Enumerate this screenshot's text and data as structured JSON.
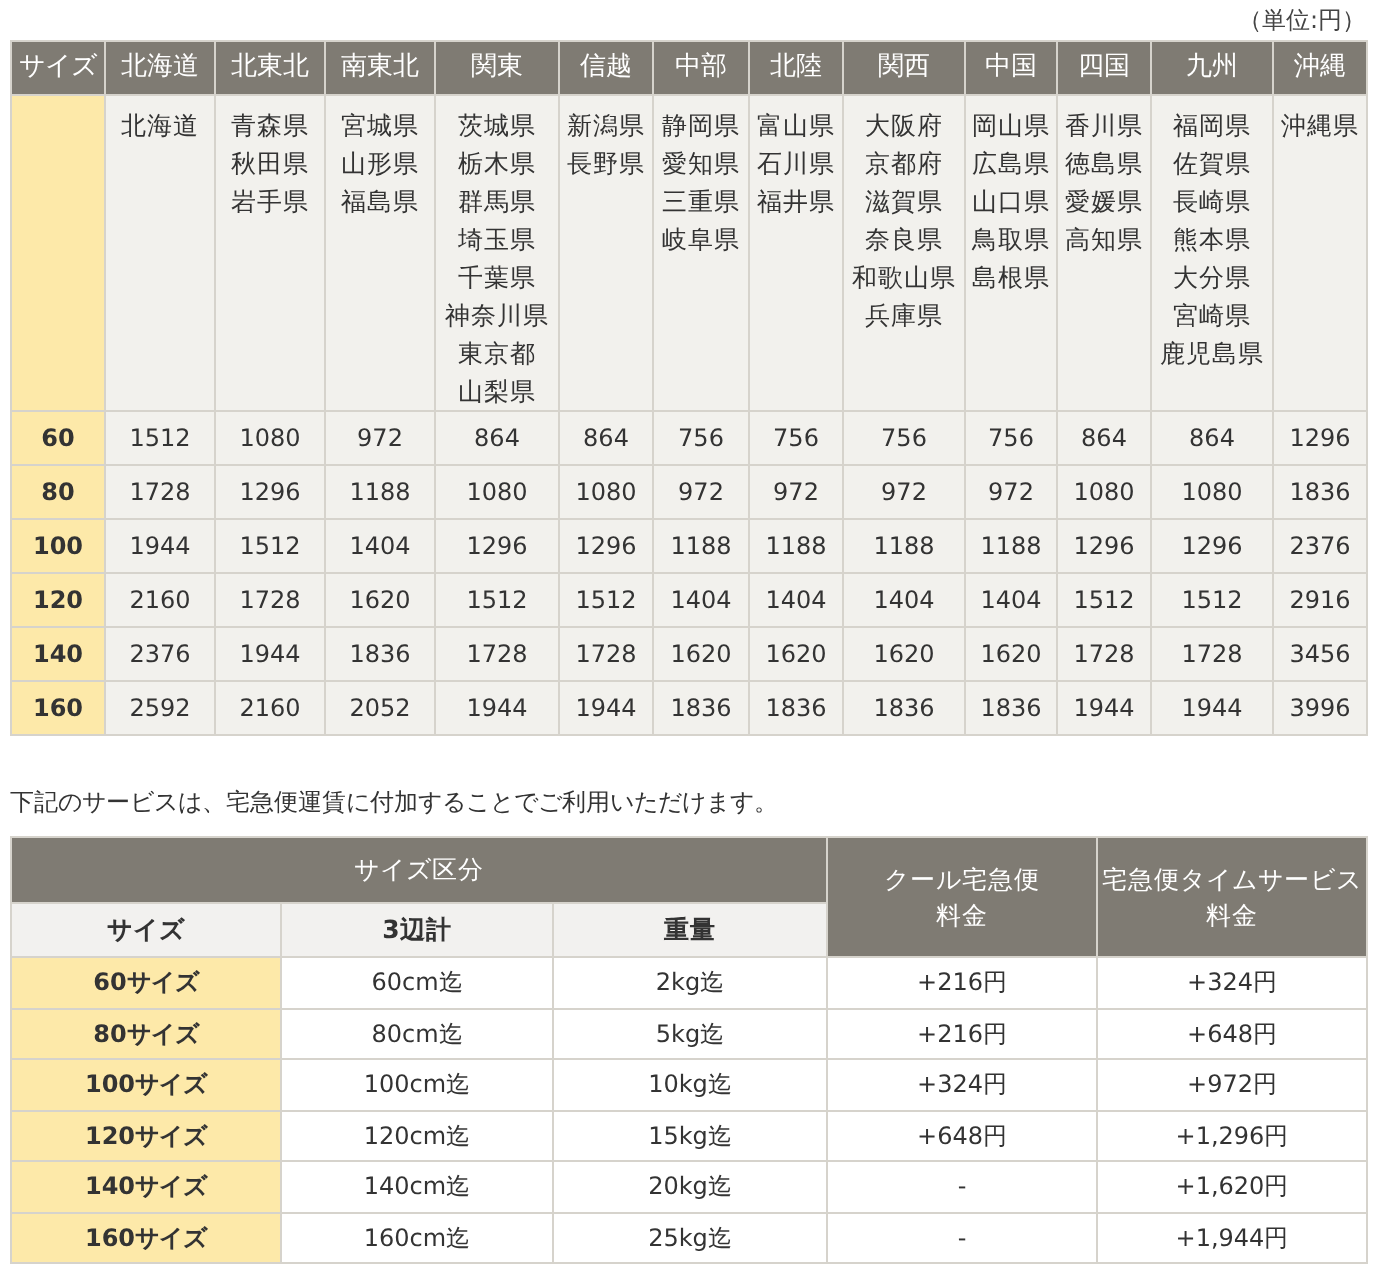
{
  "unit_note": "（単位:円）",
  "rate_table": {
    "corner": "サイズ",
    "regions": [
      {
        "name": "北海道",
        "prefectures": [
          "北海道"
        ]
      },
      {
        "name": "北東北",
        "prefectures": [
          "青森県",
          "秋田県",
          "岩手県"
        ]
      },
      {
        "name": "南東北",
        "prefectures": [
          "宮城県",
          "山形県",
          "福島県"
        ]
      },
      {
        "name": "関東",
        "prefectures": [
          "茨城県",
          "栃木県",
          "群馬県",
          "埼玉県",
          "千葉県",
          "神奈川県",
          "東京都",
          "山梨県"
        ]
      },
      {
        "name": "信越",
        "prefectures": [
          "新潟県",
          "長野県"
        ]
      },
      {
        "name": "中部",
        "prefectures": [
          "静岡県",
          "愛知県",
          "三重県",
          "岐阜県"
        ]
      },
      {
        "name": "北陸",
        "prefectures": [
          "富山県",
          "石川県",
          "福井県"
        ]
      },
      {
        "name": "関西",
        "prefectures": [
          "大阪府",
          "京都府",
          "滋賀県",
          "奈良県",
          "和歌山県",
          "兵庫県"
        ]
      },
      {
        "name": "中国",
        "prefectures": [
          "岡山県",
          "広島県",
          "山口県",
          "鳥取県",
          "島根県"
        ]
      },
      {
        "name": "四国",
        "prefectures": [
          "香川県",
          "徳島県",
          "愛媛県",
          "高知県"
        ]
      },
      {
        "name": "九州",
        "prefectures": [
          "福岡県",
          "佐賀県",
          "長崎県",
          "熊本県",
          "大分県",
          "宮崎県",
          "鹿児島県"
        ]
      },
      {
        "name": "沖縄",
        "prefectures": [
          "沖縄県"
        ]
      }
    ],
    "rows": [
      {
        "size": "60",
        "prices": [
          "1512",
          "1080",
          "972",
          "864",
          "864",
          "756",
          "756",
          "756",
          "756",
          "864",
          "864",
          "1296"
        ]
      },
      {
        "size": "80",
        "prices": [
          "1728",
          "1296",
          "1188",
          "1080",
          "1080",
          "972",
          "972",
          "972",
          "972",
          "1080",
          "1080",
          "1836"
        ]
      },
      {
        "size": "100",
        "prices": [
          "1944",
          "1512",
          "1404",
          "1296",
          "1296",
          "1188",
          "1188",
          "1188",
          "1188",
          "1296",
          "1296",
          "2376"
        ]
      },
      {
        "size": "120",
        "prices": [
          "2160",
          "1728",
          "1620",
          "1512",
          "1512",
          "1404",
          "1404",
          "1404",
          "1404",
          "1512",
          "1512",
          "2916"
        ]
      },
      {
        "size": "140",
        "prices": [
          "2376",
          "1944",
          "1836",
          "1728",
          "1728",
          "1620",
          "1620",
          "1620",
          "1620",
          "1728",
          "1728",
          "3456"
        ]
      },
      {
        "size": "160",
        "prices": [
          "2592",
          "2160",
          "2052",
          "1944",
          "1944",
          "1836",
          "1836",
          "1836",
          "1836",
          "1944",
          "1944",
          "3996"
        ]
      }
    ]
  },
  "service_note": "下記のサービスは、宅急便運賃に付加することでご利用いただけます。",
  "service_table": {
    "group_header": "サイズ区分",
    "sub_headers": [
      "サイズ",
      "3辺計",
      "重量"
    ],
    "fee_headers": [
      {
        "line1": "クール宅急便",
        "line2": "料金"
      },
      {
        "line1": "宅急便タイムサービス",
        "line2": "料金"
      }
    ],
    "rows": [
      {
        "size": "60サイズ",
        "dimensions": "60cm迄",
        "weight": "2kg迄",
        "cool": "+216円",
        "time": "+324円"
      },
      {
        "size": "80サイズ",
        "dimensions": "80cm迄",
        "weight": "5kg迄",
        "cool": "+216円",
        "time": "+648円"
      },
      {
        "size": "100サイズ",
        "dimensions": "100cm迄",
        "weight": "10kg迄",
        "cool": "+324円",
        "time": "+972円"
      },
      {
        "size": "120サイズ",
        "dimensions": "120cm迄",
        "weight": "15kg迄",
        "cool": "+648円",
        "time": "+1,296円"
      },
      {
        "size": "140サイズ",
        "dimensions": "140cm迄",
        "weight": "20kg迄",
        "cool": "-",
        "time": "+1,620円"
      },
      {
        "size": "160サイズ",
        "dimensions": "160cm迄",
        "weight": "25kg迄",
        "cool": "-",
        "time": "+1,944円"
      }
    ]
  }
}
